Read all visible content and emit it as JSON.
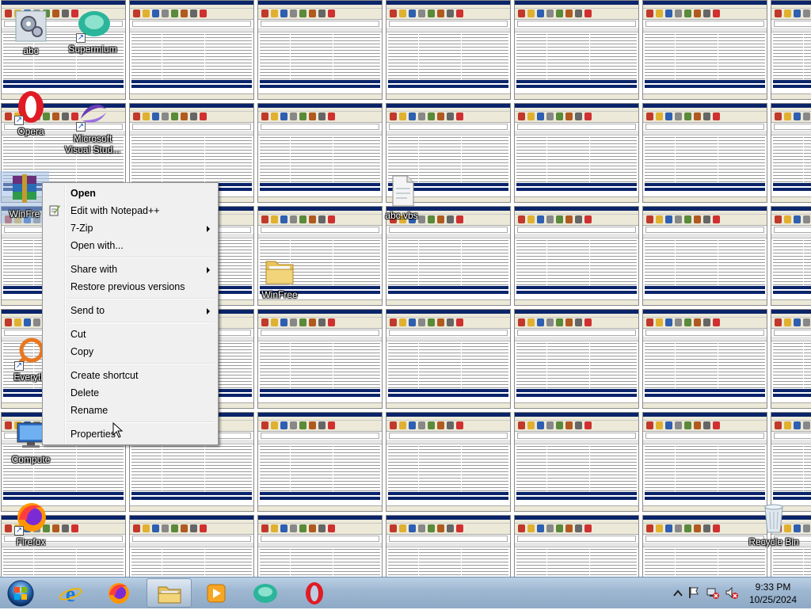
{
  "desktop_icons": [
    {
      "id": "abc",
      "label": "abc"
    },
    {
      "id": "supermium",
      "label": "Supermium"
    },
    {
      "id": "opera",
      "label": "Opera"
    },
    {
      "id": "visual-studio",
      "label": "Microsoft Visual Stud..."
    },
    {
      "id": "winfree-selected",
      "label": "WinFre"
    },
    {
      "id": "abc-vbs",
      "label": "abc.vbs"
    },
    {
      "id": "winfree-folder",
      "label": "WinFree"
    },
    {
      "id": "everything",
      "label": "Everythi"
    },
    {
      "id": "computer",
      "label": "Compute"
    },
    {
      "id": "firefox",
      "label": "Firefox"
    },
    {
      "id": "recycle-bin",
      "label": "Recycle Bin"
    }
  ],
  "context_menu": {
    "items": [
      {
        "label": "Open",
        "bold": true,
        "submenu": false
      },
      {
        "label": "Edit with Notepad++",
        "bold": false,
        "submenu": false,
        "icon": "notepad-plus-plus-icon"
      },
      {
        "label": "7-Zip",
        "bold": false,
        "submenu": true
      },
      {
        "label": "Open with...",
        "bold": false,
        "submenu": false
      },
      {
        "label": "Share with",
        "bold": false,
        "submenu": true
      },
      {
        "label": "Restore previous versions",
        "bold": false,
        "submenu": false
      },
      {
        "label": "Send to",
        "bold": false,
        "submenu": true
      },
      {
        "label": "Cut",
        "bold": false,
        "submenu": false
      },
      {
        "label": "Copy",
        "bold": false,
        "submenu": false
      },
      {
        "label": "Create shortcut",
        "bold": false,
        "submenu": false
      },
      {
        "label": "Delete",
        "bold": false,
        "submenu": false
      },
      {
        "label": "Rename",
        "bold": false,
        "submenu": false
      },
      {
        "label": "Properties",
        "bold": false,
        "submenu": false
      }
    ]
  },
  "taskbar": {
    "apps": [
      {
        "name": "internet-explorer",
        "icon": "ie-icon"
      },
      {
        "name": "firefox",
        "icon": "firefox-icon"
      },
      {
        "name": "file-explorer",
        "icon": "folder-icon",
        "active": true
      },
      {
        "name": "media-player",
        "icon": "media-player-icon"
      },
      {
        "name": "supermium",
        "icon": "supermium-icon"
      },
      {
        "name": "opera",
        "icon": "opera-icon"
      }
    ],
    "clock": {
      "time": "9:33 PM",
      "date": "10/25/2024"
    }
  },
  "colors": {
    "taskbar_top": "#bcd0e4",
    "taskbar_bottom": "#8ea9c6",
    "menu_bg": "#f0f0f0",
    "selection_navy": "#0a246a"
  }
}
